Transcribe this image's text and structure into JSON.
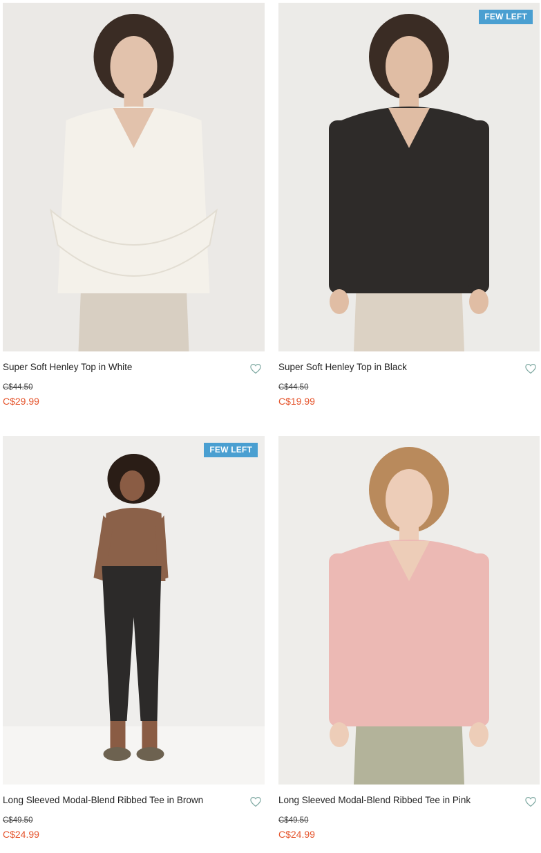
{
  "theme": {
    "sale_color": "#e5552d",
    "badge_color": "#4a9fd1",
    "heart_color": "#7fa9a2"
  },
  "products": [
    {
      "name": "Super Soft Henley Top in White",
      "badge": "",
      "original_price": "C$44.50",
      "sale_price": "C$29.99",
      "image": {
        "bg": "#ebe9e6",
        "top_color": "#f4f1ea",
        "bottom_color": "#d8cfc2",
        "hair_color": "#3a2c24",
        "skin_color": "#e2c2ac",
        "pose": "crossed-arms"
      }
    },
    {
      "name": "Super Soft Henley Top in Black",
      "badge": "FEW LEFT",
      "original_price": "C$44.50",
      "sale_price": "C$19.99",
      "image": {
        "bg": "#ecebe8",
        "top_color": "#2e2b29",
        "bottom_color": "#dcd2c4",
        "hair_color": "#3a2c24",
        "skin_color": "#e0bda4",
        "pose": "standing"
      }
    },
    {
      "name": "Long Sleeved Modal-Blend Ribbed Tee in Brown",
      "badge": "FEW LEFT",
      "original_price": "C$49.50",
      "sale_price": "C$24.99",
      "image": {
        "bg": "#efeeec",
        "top_color": "#8b6149",
        "bottom_color": "#2c2a29",
        "hair_color": "#2a1d16",
        "skin_color": "#8a5c44",
        "pose": "full-body"
      }
    },
    {
      "name": "Long Sleeved Modal-Blend Ribbed Tee in Pink",
      "badge": "",
      "original_price": "C$49.50",
      "sale_price": "C$24.99",
      "image": {
        "bg": "#eeedea",
        "top_color": "#ecb9b4",
        "bottom_color": "#b3b39a",
        "hair_color": "#b98a5c",
        "skin_color": "#edcdb8",
        "pose": "standing"
      }
    }
  ]
}
